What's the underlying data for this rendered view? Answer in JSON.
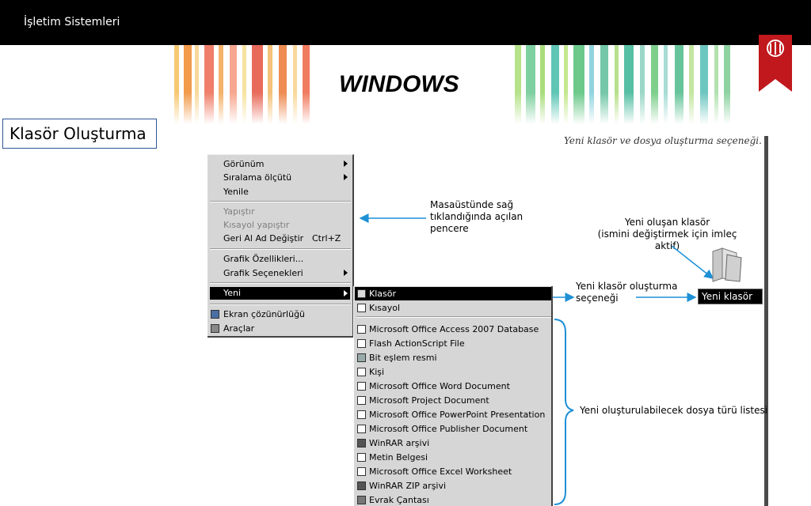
{
  "header": {
    "title": "İşletim Sistemleri"
  },
  "slide": {
    "heading": "WINDOWS",
    "section_label": "Klasör Oluşturma"
  },
  "figure": {
    "caption": "Yeni klasör ve dosya oluşturma seçeneği.",
    "context_menu": {
      "items": [
        {
          "label": "Görünüm",
          "submenu": true
        },
        {
          "label": "Sıralama ölçütü",
          "submenu": true
        },
        {
          "label": "Yenile"
        },
        {
          "label": "Yapıştır",
          "disabled": true
        },
        {
          "label": "Kısayol yapıştır",
          "disabled": true
        },
        {
          "label": "Geri Al Ad Değiştir",
          "shortcut": "Ctrl+Z"
        },
        {
          "label": "Grafik Özellikleri..."
        },
        {
          "label": "Grafik Seçenekleri",
          "submenu": true
        },
        {
          "label": "Yeni",
          "submenu": true,
          "highlighted": true
        },
        {
          "label": "Ekran çözünürlüğü",
          "icon": "monitor-icon"
        },
        {
          "label": "Araçlar",
          "icon": "tools-icon"
        }
      ]
    },
    "new_submenu": {
      "items": [
        {
          "label": "Klasör",
          "highlighted": true,
          "icon": "folder-icon"
        },
        {
          "label": "Kısayol",
          "icon": "shortcut-icon"
        },
        {
          "label": "Microsoft Office Access 2007 Database",
          "icon": "access-icon"
        },
        {
          "label": "Flash ActionScript File",
          "icon": "flash-icon"
        },
        {
          "label": "Bit eşlem resmi",
          "icon": "bitmap-icon"
        },
        {
          "label": "Kişi",
          "icon": "contact-icon"
        },
        {
          "label": "Microsoft Office Word Document",
          "icon": "word-icon"
        },
        {
          "label": "Microsoft Project Document",
          "icon": "project-icon"
        },
        {
          "label": "Microsoft Office PowerPoint Presentation",
          "icon": "powerpoint-icon"
        },
        {
          "label": "Microsoft Office Publisher Document",
          "icon": "publisher-icon"
        },
        {
          "label": "WinRAR arşivi",
          "icon": "winrar-icon"
        },
        {
          "label": "Metin Belgesi",
          "icon": "text-file-icon"
        },
        {
          "label": "Microsoft Office Excel Worksheet",
          "icon": "excel-icon"
        },
        {
          "label": "WinRAR ZIP arşivi",
          "icon": "winrar-zip-icon"
        },
        {
          "label": "Evrak Çantası",
          "icon": "briefcase-icon"
        }
      ]
    },
    "annotations": {
      "desktop_menu": [
        "Masaüstünde sağ",
        "tıklandığında açılan",
        "pencere"
      ],
      "new_folder": [
        "Yeni oluşan klasör",
        "(ismini değiştirmek için imleç aktif)"
      ],
      "folder_option": [
        "Yeni klasör oluşturma",
        "seçeneği"
      ],
      "file_types": "Yeni oluşturulabilecek dosya türü listesi"
    },
    "new_folder_name": "Yeni klasör"
  },
  "colors": {
    "topbar": "#000000",
    "annotation_arrow": "#1e90d6",
    "highlight": "#000000",
    "menu_bg": "#d6d6d6",
    "bookmark": "#c0181c"
  }
}
